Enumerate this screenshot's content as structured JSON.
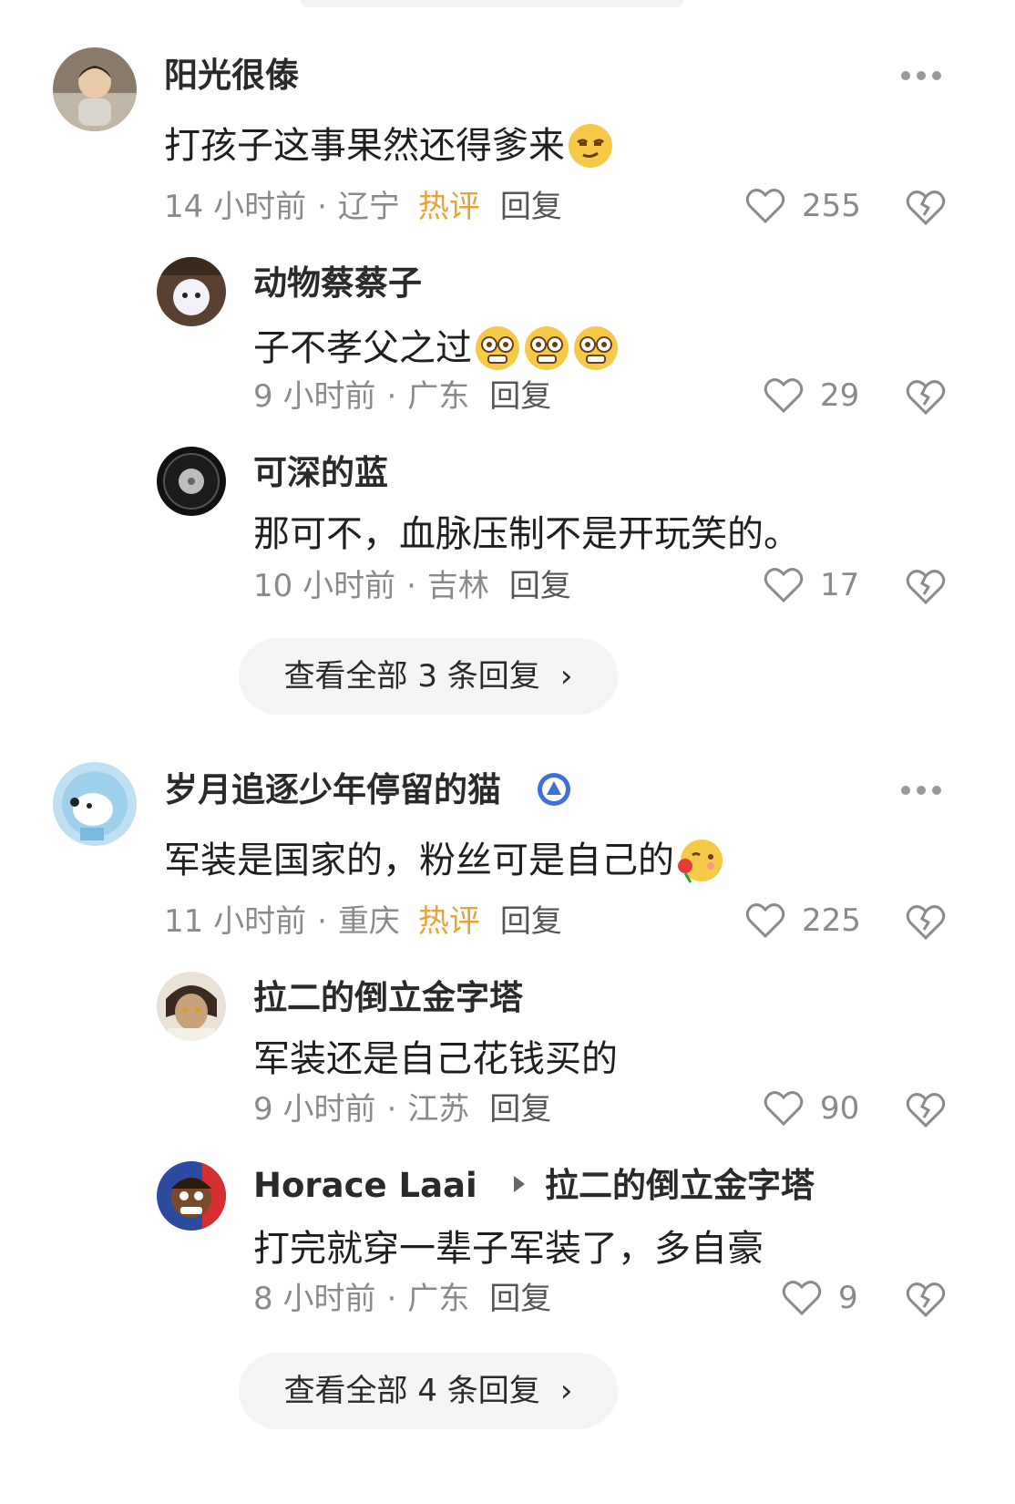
{
  "comments": [
    {
      "name": "阳光很傣",
      "text": "打孩子这事果然还得爹来",
      "time": "14 小时前",
      "location": "辽宁",
      "hot": "热评",
      "reply": "回复",
      "likes": "255",
      "replies": [
        {
          "name": "动物蔡蔡子",
          "text": "子不孝父之过",
          "time": "9 小时前",
          "location": "广东",
          "reply": "回复",
          "likes": "29"
        },
        {
          "name": "可深的蓝",
          "text": "那可不，血脉压制不是开玩笑的。",
          "time": "10 小时前",
          "location": "吉林",
          "reply": "回复",
          "likes": "17"
        }
      ],
      "view_all": "查看全部 3 条回复"
    },
    {
      "name": "岁月追逐少年停留的猫",
      "text": "军装是国家的，粉丝可是自己的",
      "time": "11 小时前",
      "location": "重庆",
      "hot": "热评",
      "reply": "回复",
      "likes": "225",
      "replies": [
        {
          "name": "拉二的倒立金字塔",
          "text": "军装还是自己花钱买的",
          "time": "9 小时前",
          "location": "江苏",
          "reply": "回复",
          "likes": "90"
        },
        {
          "name": "Horace Laai",
          "reply_to": "拉二的倒立金字塔",
          "text": "打完就穿一辈子军装了，多自豪",
          "time": "8 小时前",
          "location": "广东",
          "reply": "回复",
          "likes": "9"
        }
      ],
      "view_all": "查看全部 4 条回复"
    }
  ],
  "separator": "·",
  "chevron": "›",
  "icons": {
    "like": "heart-outline-icon",
    "dislike": "broken-heart-icon",
    "more": "more-dots-icon"
  },
  "colors": {
    "hot": "#e8a33a",
    "meta": "#8a8a8a",
    "pill_bg": "#f5f5f5"
  }
}
